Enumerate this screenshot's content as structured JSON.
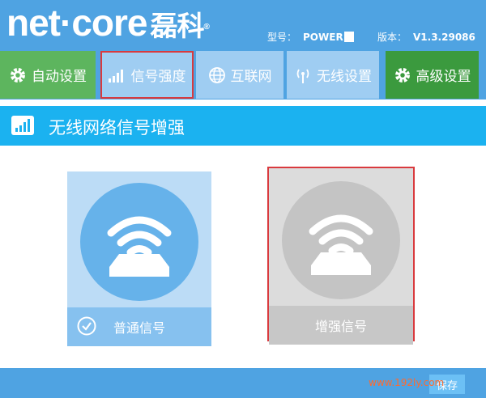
{
  "brand": {
    "logo_text": "net·core",
    "logo_cn": "磊科",
    "reg_mark": "®"
  },
  "header": {
    "model_label": "型号：",
    "model_value": "POWER",
    "version_label": "版本：",
    "version_value": "V1.3.29086"
  },
  "nav": {
    "tabs": [
      {
        "label": "自动设置",
        "icon": "gear-icon",
        "color": "#5db55e"
      },
      {
        "label": "信号强度",
        "icon": "signal-bars-icon",
        "selected": true
      },
      {
        "label": "互联网",
        "icon": "globe-icon"
      },
      {
        "label": "无线设置",
        "icon": "wireless-antenna-icon"
      },
      {
        "label": "高级设置",
        "icon": "gear-icon",
        "color": "#3b9a3e"
      }
    ]
  },
  "section": {
    "title": "无线网络信号增强",
    "icon": "signal-bars-icon"
  },
  "options": [
    {
      "label": "普通信号",
      "checked": true,
      "icon": "router-wifi-icon"
    },
    {
      "label": "增强信号",
      "checked": false,
      "icon": "router-wifi-icon",
      "highlighted": true
    }
  ],
  "footer": {
    "save_label": "保存",
    "watermark": "www.192ly.com"
  },
  "colors": {
    "header": "#4fa3e2",
    "section": "#1bb2f0",
    "highlight_border": "#d93a3e",
    "green": "#5db55e",
    "dark_green": "#3b9a3e",
    "tab_inactive": "#9fcdf2"
  }
}
